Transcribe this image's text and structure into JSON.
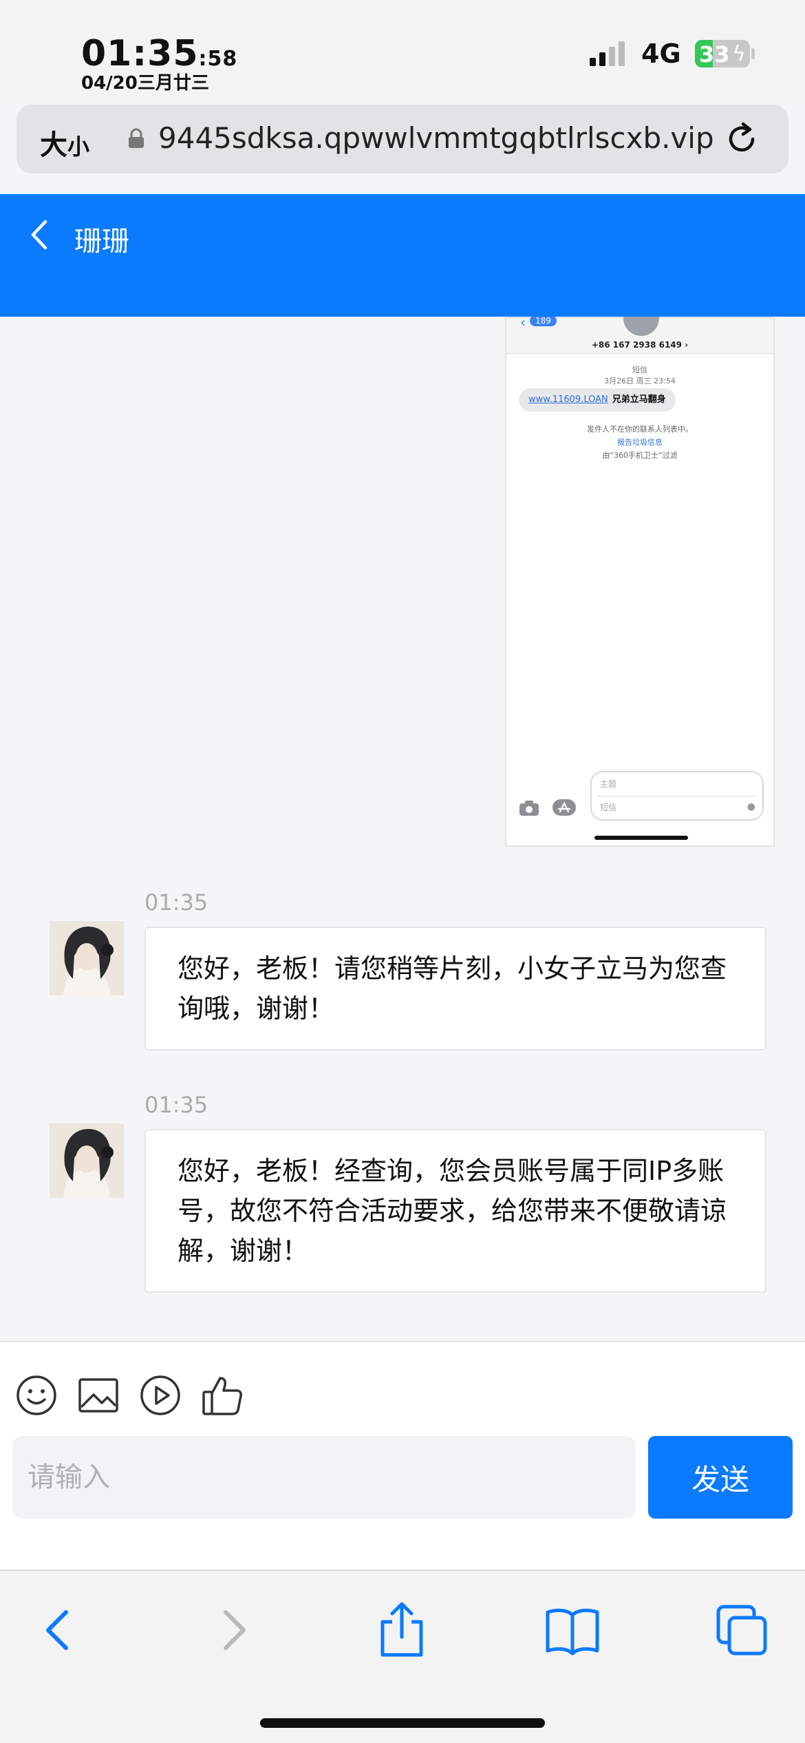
{
  "status_bar": {
    "time": "01:35",
    "seconds": ":58",
    "date": "04/20三月廿三",
    "network": "4G",
    "battery_level": "33",
    "battery_fraction": 0.33
  },
  "url_bar": {
    "size_label_big": "大",
    "size_label_small": "小",
    "url": "9445sdksa.qpwwlvmmtgqbtlrlscxb.vip"
  },
  "header": {
    "title": "珊珊"
  },
  "sms_screenshot": {
    "badge": "189",
    "phone_number": "+86 167 2938 6149 ›",
    "meta_label": "短信",
    "meta_date": "3月26日 周三 23:54",
    "link_text": "www.11609.LOAN",
    "bubble_text": "兄弟立马翻身",
    "notice_line1": "发件人不在你的联系人列表中。",
    "notice_line2": "报告垃圾信息",
    "notice_line3": "由“360手机卫士”过滤",
    "subject_placeholder": "主题",
    "body_placeholder": "短信"
  },
  "messages": [
    {
      "time": "01:35",
      "text": "您好，老板！请您稍等片刻，小女子立马为您查询哦，谢谢！"
    },
    {
      "time": "01:35",
      "text": "您好，老板！经查询，您会员账号属于同IP多账号，故您不符合活动要求，给您带来不便敬请谅解，谢谢！"
    }
  ],
  "composer": {
    "placeholder": "请输入",
    "send_label": "发送"
  },
  "colors": {
    "brand_blue": "#0a7aff",
    "battery_green": "#35c759"
  }
}
